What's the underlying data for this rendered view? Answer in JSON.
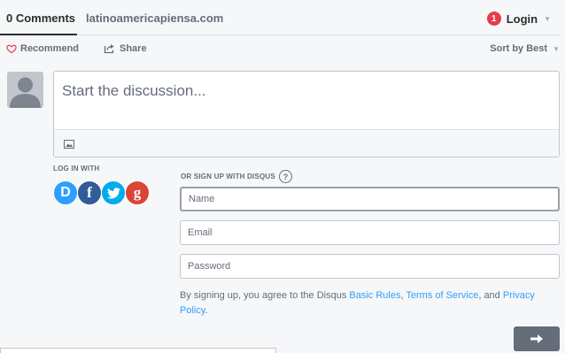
{
  "nav": {
    "comments_tab": "0 Comments",
    "site_tab": "latinoamericapiensa.com",
    "login_badge": "1",
    "login_label": "Login"
  },
  "actions": {
    "recommend": "Recommend",
    "share": "Share",
    "sort": "Sort by Best"
  },
  "composer": {
    "placeholder": "Start the discussion..."
  },
  "login_with": {
    "label": "LOG IN WITH",
    "providers": [
      {
        "name": "disqus",
        "glyph": "D",
        "color": "#2e9fff"
      },
      {
        "name": "facebook",
        "glyph": "f",
        "color": "#305c99"
      },
      {
        "name": "twitter",
        "glyph": "twitter-bird-icon",
        "color": "#00aced"
      },
      {
        "name": "google",
        "glyph": "g",
        "color": "#db4437"
      }
    ]
  },
  "signup": {
    "label": "OR SIGN UP WITH DISQUS",
    "help": "?",
    "name_placeholder": "Name",
    "email_placeholder": "Email",
    "password_placeholder": "Password",
    "terms_prefix": "By signing up, you agree to the Disqus ",
    "basic_rules": "Basic Rules",
    "comma": ", ",
    "terms_of_service": "Terms of Service",
    "and": ", and ",
    "privacy_policy": "Privacy Policy",
    "period": "."
  },
  "colors": {
    "accent": "#2e9fff",
    "badge": "#e53e4a",
    "heart": "#e53e4a",
    "text_muted": "#656c7a",
    "submit_bg": "#656c7a"
  }
}
